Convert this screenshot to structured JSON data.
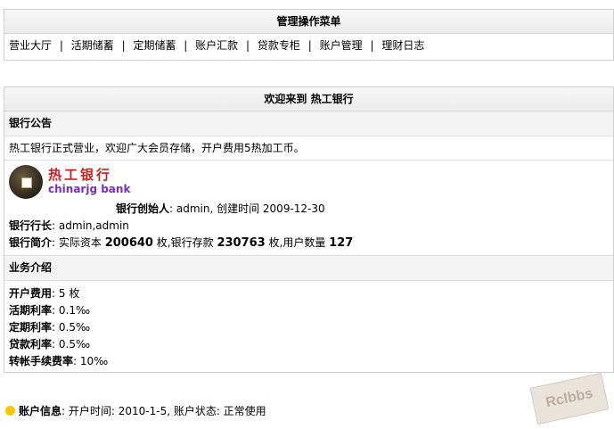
{
  "menu": {
    "title": "管理操作菜单",
    "items": [
      "营业大厅",
      "活期储蓄",
      "定期储蓄",
      "账户汇款",
      "贷款专柜",
      "账户管理",
      "理财日志"
    ],
    "separator": "|"
  },
  "bank": {
    "welcome": "欢迎来到 热工银行",
    "notice_title": "银行公告",
    "notice_text": "热工银行正式营业，欢迎广大会员存储，开户费用5热加工币。",
    "logo_cn": "热工银行",
    "logo_en": "chinarjg bank",
    "founder_label": "银行创始人",
    "founder_value": ": admin, 创建时间  2009-12-30",
    "president_label": "银行行长",
    "president_value": ": admin,admin",
    "intro_label": "银行简介",
    "intro_prefix": ": 实际资本 ",
    "capital": "200640",
    "intro_mid": " 枚,银行存款 ",
    "deposits": "230763",
    "intro_mid2": " 枚,用户数量 ",
    "users": "127"
  },
  "business": {
    "title": "业务介绍",
    "rows": [
      {
        "label": "开户费用",
        "value": ": 5 枚"
      },
      {
        "label": "活期利率",
        "value": ": 0.1‰"
      },
      {
        "label": "定期利率",
        "value": ": 0.5‰"
      },
      {
        "label": "贷款利率",
        "value": ": 0.5‰"
      },
      {
        "label": "转帐手续费率",
        "value": ": 10‰"
      }
    ]
  },
  "account": {
    "label": "账户信息",
    "value": ": 开户时间: 2010-1-5, 账户状态: 正常使用"
  },
  "icons": {
    "tip": "lightbulb-icon",
    "logo": "coin-icon"
  },
  "watermark": "Rclbbs"
}
